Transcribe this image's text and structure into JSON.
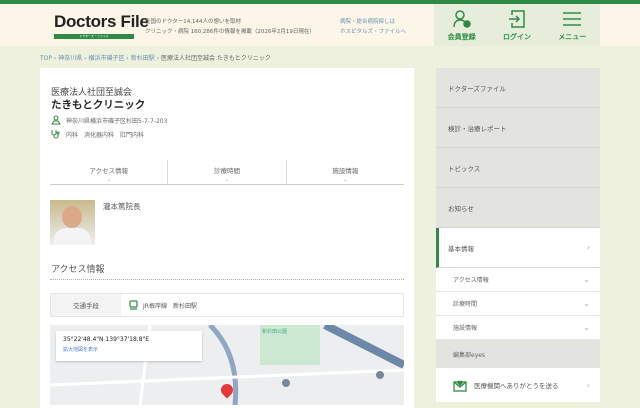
{
  "header": {
    "logo": "Doctors File",
    "logo_sub": "ドクターズ・ファイル",
    "tagline1": "全国のドクター14,144人の想いを取材",
    "tagline2": "クリニック・病院 160,286件の情報を掲載（2026年2月19日現在）",
    "hosp_link1": "病院・総合病院探しは",
    "hosp_link2": "ホスピタルズ・ファイルへ",
    "register": "会員登録",
    "login": "ログイン",
    "menu": "メニュー"
  },
  "breadcrumb": [
    "TOP",
    "神奈川県",
    "横浜市磯子区",
    "新杉田駅",
    "医療法人社団至誠会 たきもとクリニック"
  ],
  "clinic": {
    "corp": "医療法人社団至誠会",
    "name": "たきもとクリニック",
    "address": "神奈川県横浜市磯子区杉田5-7-7-203",
    "departments": "内科　消化器内科　肛門内科"
  },
  "tabs": [
    "アクセス情報",
    "診療時間",
    "施設情報"
  ],
  "doctor": {
    "name": "瀧本篤院長"
  },
  "access": {
    "heading": "アクセス情報",
    "label": "交通手段",
    "value": "JR根岸線　新杉田駅"
  },
  "map": {
    "coords": "35°22'48.4\"N 139°37'18.8\"E",
    "enlarge": "拡大地図を表示",
    "park": "新杉田公園"
  },
  "sidebar": {
    "items": [
      "ドクターズファイル",
      "検診・治療レポート",
      "トピックス",
      "お知らせ"
    ],
    "active": "基本情報",
    "subs": [
      "アクセス情報",
      "診療時間",
      "施設情報"
    ],
    "eyes": "編集部eyes",
    "thanks": "医療機関へありがとうを送る"
  }
}
